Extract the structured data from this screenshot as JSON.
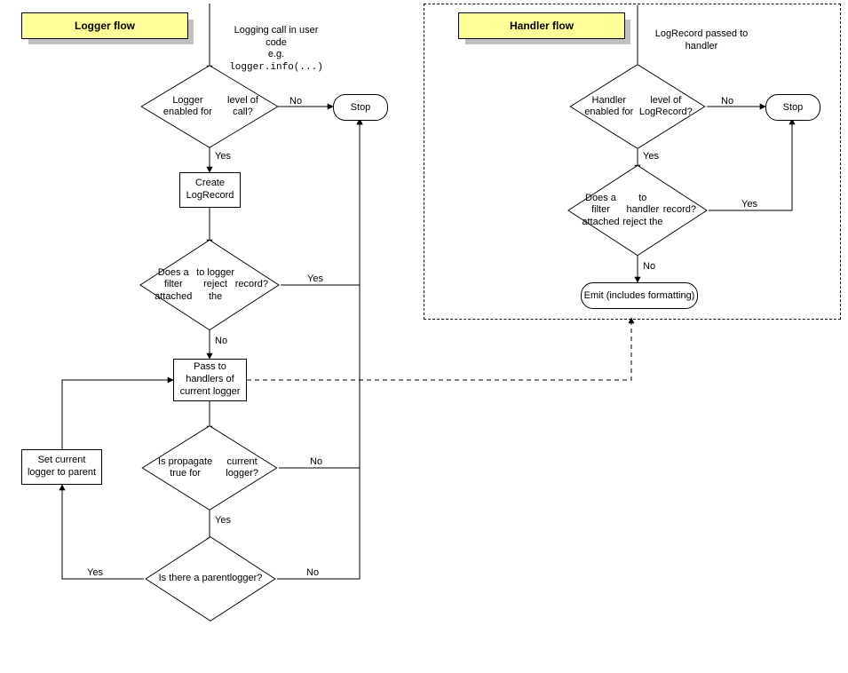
{
  "titles": {
    "logger": "Logger flow",
    "handler": "Handler flow"
  },
  "logger": {
    "incoming_l1": "Logging call in user",
    "incoming_l2": "code",
    "incoming_l3": "e.g.",
    "incoming_code": "logger.info(...)",
    "d1_l1": "Logger enabled for",
    "d1_l2": "level of call?",
    "d1_no": "No",
    "d1_yes": "Yes",
    "stop": "Stop",
    "p1_l1": "Create",
    "p1_l2": "LogRecord",
    "d2_l1": "Does a filter attached",
    "d2_l2": "to logger reject the",
    "d2_l3": "record?",
    "d2_yes": "Yes",
    "d2_no": "No",
    "p2_l1": "Pass to",
    "p2_l2": "handlers of",
    "p2_l3": "current logger",
    "d3_l1": "Is propagate true for",
    "d3_l2": "current logger?",
    "d3_no": "No",
    "d3_yes": "Yes",
    "d4_l1": "Is there a parent",
    "d4_l2": "logger?",
    "d4_yes": "Yes",
    "d4_no": "No",
    "loop_l1": "Set current",
    "loop_l2": "logger to parent"
  },
  "handler": {
    "incoming_l1": "LogRecord passed to",
    "incoming_l2": "handler",
    "d1_l1": "Handler enabled for",
    "d1_l2": "level of LogRecord?",
    "d1_no": "No",
    "d1_yes": "Yes",
    "stop": "Stop",
    "d2_l1": "Does a filter attached",
    "d2_l2": "to handler reject the",
    "d2_l3": "record?",
    "d2_yes": "Yes",
    "d2_no": "No",
    "emit": "Emit (includes formatting)"
  }
}
